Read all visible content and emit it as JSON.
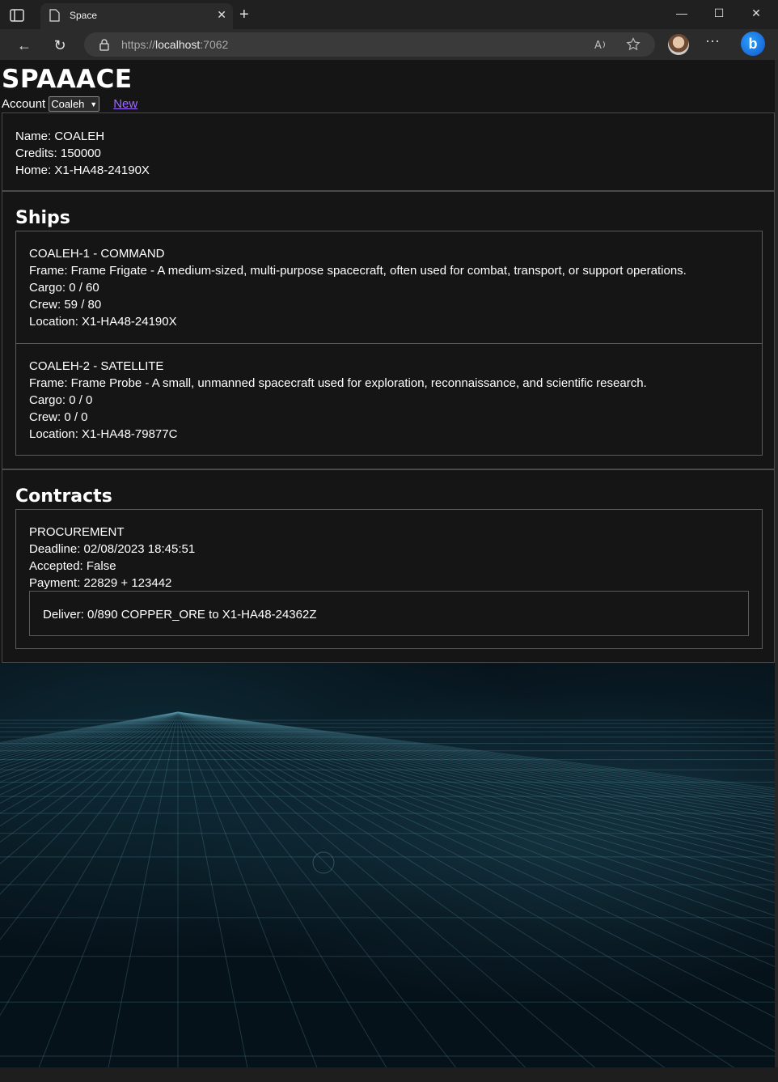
{
  "browser": {
    "tab_title": "Space",
    "url_scheme": "https://",
    "url_host": "localhost",
    "url_port": ":7062"
  },
  "app": {
    "title": "SPAAACE",
    "account_label": "Account",
    "account_selected": "Coaleh",
    "new_link": "New"
  },
  "agent": {
    "name": "Name: COALEH",
    "credits": "Credits: 150000",
    "home": "Home: X1-HA48-24190X"
  },
  "ships": {
    "heading": "Ships",
    "items": [
      {
        "title": "COALEH-1 - COMMAND",
        "frame": "Frame: Frame Frigate - A medium-sized, multi-purpose spacecraft, often used for combat, transport, or support operations.",
        "cargo": "Cargo: 0 / 60",
        "crew": "Crew: 59 / 80",
        "location": "Location: X1-HA48-24190X"
      },
      {
        "title": "COALEH-2 - SATELLITE",
        "frame": "Frame: Frame Probe - A small, unmanned spacecraft used for exploration, reconnaissance, and scientific research.",
        "cargo": "Cargo: 0 / 0",
        "crew": "Crew: 0 / 0",
        "location": "Location: X1-HA48-79877C"
      }
    ]
  },
  "contracts": {
    "heading": "Contracts",
    "items": [
      {
        "type": "PROCUREMENT",
        "deadline": "Deadline: 02/08/2023 18:45:51",
        "accepted": "Accepted: False",
        "payment": "Payment: 22829 + 123442",
        "deliver": "Deliver: 0/890 COPPER_ORE to X1-HA48-24362Z"
      }
    ]
  },
  "colors": {
    "link": "#9d6bff",
    "page_bg": "#151515",
    "border": "#5a5a5a"
  }
}
